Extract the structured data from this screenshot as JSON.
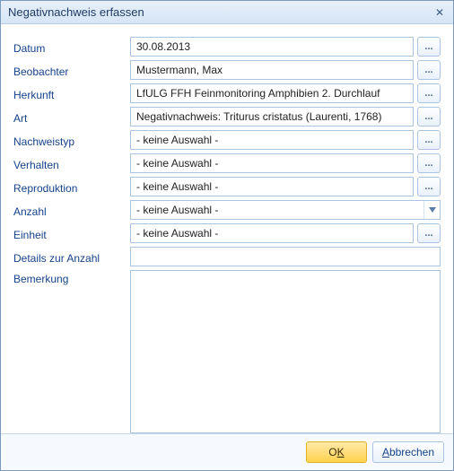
{
  "window": {
    "title": "Negativnachweis erfassen"
  },
  "labels": {
    "datum": "Datum",
    "beobachter": "Beobachter",
    "herkunft": "Herkunft",
    "art": "Art",
    "nachweistyp": "Nachweistyp",
    "verhalten": "Verhalten",
    "reproduktion": "Reproduktion",
    "anzahl": "Anzahl",
    "einheit": "Einheit",
    "details": "Details zur Anzahl",
    "bemerkung": "Bemerkung"
  },
  "values": {
    "datum": "30.08.2013",
    "beobachter": "Mustermann, Max",
    "herkunft": "LfULG FFH Feinmonitoring Amphibien 2. Durchlauf",
    "art": "Negativnachweis: Triturus cristatus (Laurenti, 1768)",
    "nachweistyp": "- keine Auswahl -",
    "verhalten": "- keine Auswahl -",
    "reproduktion": "- keine Auswahl -",
    "anzahl": "- keine Auswahl -",
    "einheit": "- keine Auswahl -",
    "details": "",
    "bemerkung": ""
  },
  "buttons": {
    "lookup": "...",
    "ok_prefix": "O",
    "ok_ul": "K",
    "cancel_ul": "A",
    "cancel_suffix": "bbrechen"
  }
}
